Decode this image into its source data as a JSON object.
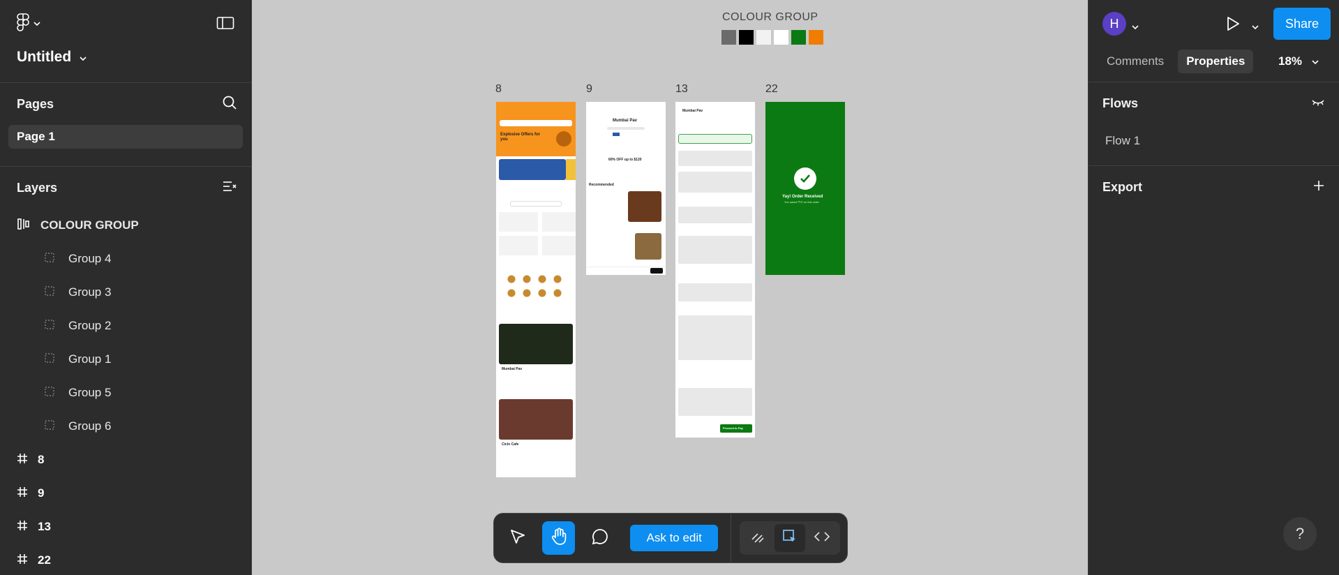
{
  "file": {
    "title": "Untitled"
  },
  "pages": {
    "heading": "Pages",
    "items": [
      "Page 1"
    ]
  },
  "layers": {
    "heading": "Layers",
    "root": "COLOUR GROUP",
    "children": [
      "Group 4",
      "Group 3",
      "Group 2",
      "Group 1",
      "Group 5",
      "Group 6"
    ],
    "frames": [
      "8",
      "9",
      "13",
      "22"
    ]
  },
  "right": {
    "avatar_initial": "H",
    "share_label": "Share",
    "tabs": [
      "Comments",
      "Properties"
    ],
    "active_tab": "Properties",
    "zoom": "18%",
    "flows_heading": "Flows",
    "flows": [
      "Flow 1"
    ],
    "export_heading": "Export",
    "help": "?"
  },
  "canvas": {
    "colour_group_title": "COLOUR GROUP",
    "swatches": [
      "#6b6b6b",
      "#000000",
      "#f2f2f2",
      "#ffffff",
      "#0b7a12",
      "#f07c00"
    ],
    "frame_labels": [
      "8",
      "9",
      "13",
      "22"
    ],
    "screen22": {
      "title": "Yay! Order Received",
      "sub": "You saved ₹70 on this order"
    },
    "screen8": {
      "offers": "Explosive Offers for you",
      "restaurant1": "Mumbai Pav",
      "restaurant2": "Ciclo Cafe"
    },
    "screen9": {
      "title": "Mumbai Pav",
      "offer": "60% OFF up to $120",
      "section": "Recommended"
    },
    "screen13": {
      "header": "Mumbai Pav",
      "cta": "Proceed to Pay"
    }
  },
  "toolbar": {
    "ask_label": "Ask to edit"
  },
  "colors": {
    "accent": "#0d8ef0",
    "panel": "#2c2c2c",
    "canvas": "#c9c9c9"
  }
}
